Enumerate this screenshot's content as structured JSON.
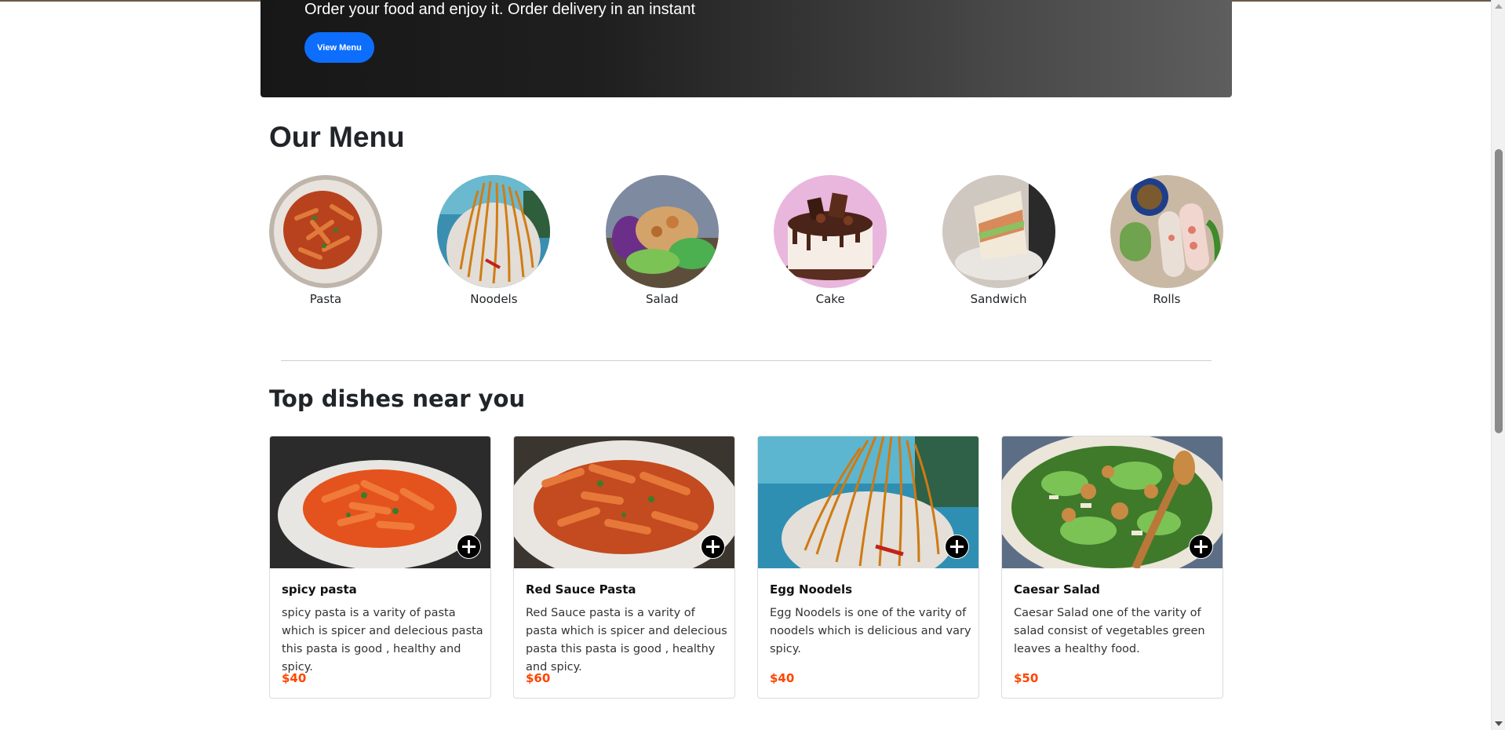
{
  "hero": {
    "tagline": "Order your food and enjoy it. Order delivery in an instant",
    "button_label": "View Menu"
  },
  "menu": {
    "title": "Our Menu",
    "categories": [
      {
        "label": "Pasta",
        "image": "pasta-photo"
      },
      {
        "label": "Noodels",
        "image": "noodles-photo"
      },
      {
        "label": "Salad",
        "image": "salad-photo"
      },
      {
        "label": "Cake",
        "image": "cake-photo"
      },
      {
        "label": "Sandwich",
        "image": "sandwich-photo"
      },
      {
        "label": "Rolls",
        "image": "rolls-photo"
      }
    ]
  },
  "top_dishes": {
    "title": "Top dishes near you",
    "items": [
      {
        "name": "spicy pasta",
        "description": "spicy pasta is a varity of pasta which is spicer and delecious pasta this pasta is good , healthy and spicy.",
        "price": "$40",
        "image": "penne-bowl-photo"
      },
      {
        "name": "Red Sauce Pasta",
        "description": "Red Sauce pasta is a varity of pasta which is spicer and delecious pasta this pasta is good , healthy and spicy.",
        "price": "$60",
        "image": "penne-plate-photo"
      },
      {
        "name": "Egg Noodels",
        "description": "Egg Noodels is one of the varity of noodels which is delicious and vary spicy.",
        "price": "$40",
        "image": "noodles-bowl-photo"
      },
      {
        "name": "Caesar Salad",
        "description": "Caesar Salad one of the varity of salad consist of vegetables green leaves a healthy food.",
        "price": "$50",
        "image": "caesar-salad-photo"
      }
    ]
  },
  "colors": {
    "primary_button": "#0d6efd",
    "price": "#ff4500",
    "hero_dark": "#171717"
  }
}
